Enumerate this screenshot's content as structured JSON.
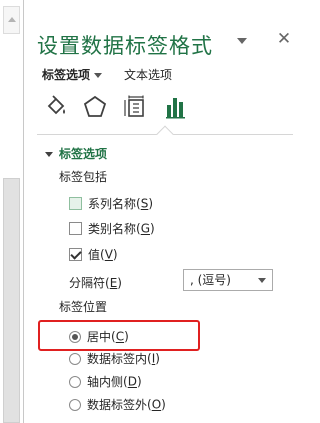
{
  "pane": {
    "title": "设置数据标签格式",
    "tabs": [
      {
        "label": "标签选项",
        "active": true
      },
      {
        "label": "文本选项",
        "active": false
      }
    ],
    "icons": [
      "paint-bucket-icon",
      "pentagon-effects-icon",
      "size-properties-icon",
      "bar-chart-options-icon"
    ],
    "section": {
      "title": "标签选项",
      "include_label": "标签包括",
      "checkboxes": [
        {
          "label": "系列名称",
          "hotkey": "S",
          "checked": false,
          "highlighted": true
        },
        {
          "label": "类别名称",
          "hotkey": "G",
          "checked": false
        },
        {
          "label": "值",
          "hotkey": "V",
          "checked": true
        }
      ],
      "separator": {
        "label": "分隔符",
        "hotkey": "E",
        "value": ", (逗号)"
      },
      "position_label": "标签位置",
      "positions": [
        {
          "label": "居中",
          "hotkey": "C",
          "selected": true
        },
        {
          "label": "数据标签内",
          "hotkey": "I",
          "selected": false
        },
        {
          "label": "轴内侧",
          "hotkey": "D",
          "selected": false
        },
        {
          "label": "数据标签外",
          "hotkey": "O",
          "selected": false
        }
      ]
    }
  },
  "colors": {
    "accent_green": "#217346",
    "highlight_red": "#e02020"
  }
}
